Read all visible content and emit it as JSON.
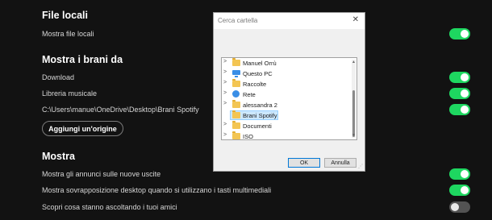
{
  "settings": {
    "local_files": {
      "heading": "File locali",
      "show_label": "Mostra file locali"
    },
    "show_tracks_from": {
      "heading": "Mostra i brani da",
      "items": [
        {
          "label": "Download",
          "enabled": true
        },
        {
          "label": "Libreria musicale",
          "enabled": true
        },
        {
          "label": "C:\\Users\\manue\\OneDrive\\Desktop\\Brani Spotify",
          "enabled": true
        }
      ],
      "add_source_label": "Aggiungi un'origine"
    },
    "display": {
      "heading": "Mostra",
      "items": [
        {
          "label": "Mostra gli annunci sulle nuove uscite",
          "enabled": true
        },
        {
          "label": "Mostra sovrapposizione desktop quando si utilizzano i tasti multimediali",
          "enabled": true
        },
        {
          "label": "Scopri cosa stanno ascoltando i tuoi amici",
          "enabled": false
        }
      ]
    }
  },
  "dialog": {
    "title": "Cerca cartella",
    "close_glyph": "✕",
    "tree": [
      {
        "label": "Manuel Orrù",
        "icon": "folder-icon",
        "expandable": true
      },
      {
        "label": "Questo PC",
        "icon": "pc-icon",
        "expandable": true
      },
      {
        "label": "Raccolte",
        "icon": "folder-icon",
        "expandable": true
      },
      {
        "label": "Rete",
        "icon": "network-icon",
        "expandable": true
      },
      {
        "label": "alessandra 2",
        "icon": "folder-icon",
        "expandable": true
      },
      {
        "label": "Brani Spotify",
        "icon": "folder-icon",
        "expandable": false,
        "selected": true
      },
      {
        "label": "Documenti",
        "icon": "folder-icon",
        "expandable": true
      },
      {
        "label": "ISO",
        "icon": "folder-icon",
        "expandable": true
      }
    ],
    "ok_label": "OK",
    "cancel_label": "Annulla"
  },
  "colors": {
    "background": "#121212",
    "toggle_on": "#1ed760",
    "toggle_off": "#535353",
    "dialog_bg": "#f0f0f0",
    "selection": "#cce8ff"
  }
}
